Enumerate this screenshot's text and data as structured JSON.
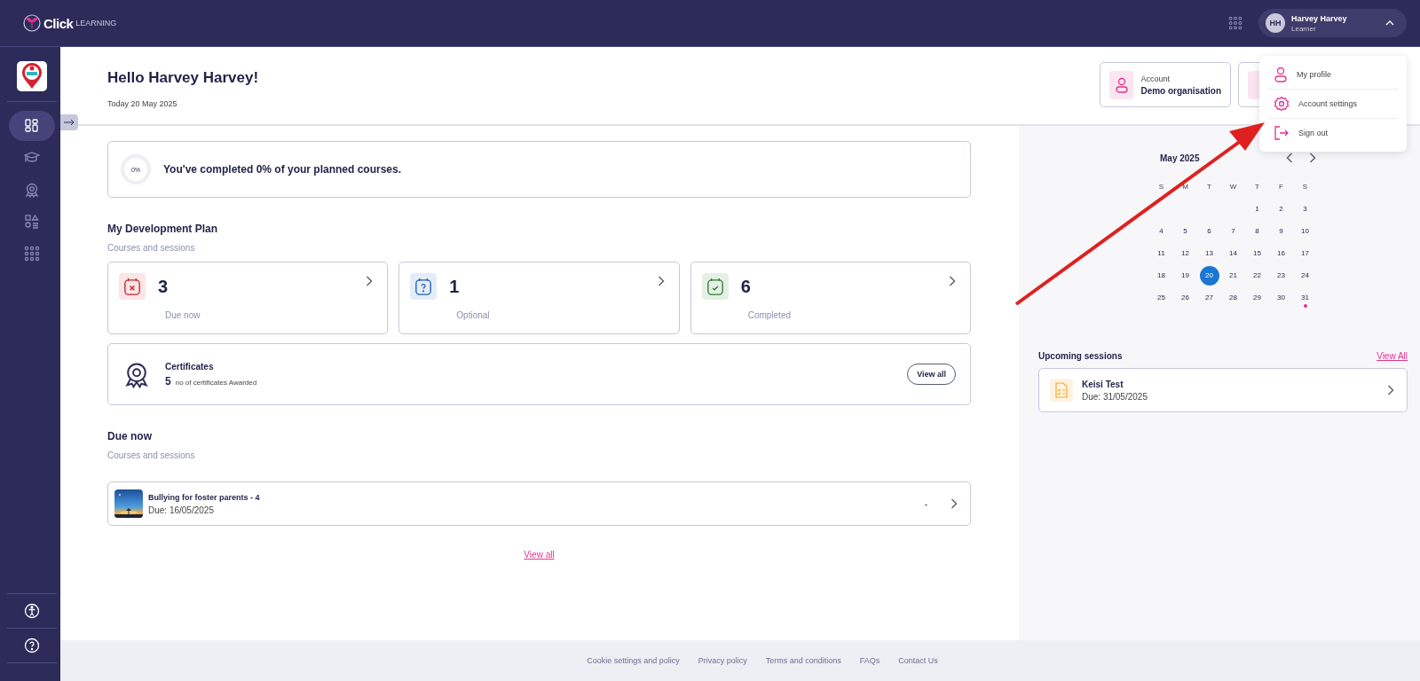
{
  "top_bar": {
    "logo_text": "Click",
    "logo_sub": "LEARNING",
    "user": {
      "initials": "HH",
      "name": "Harvey Harvey",
      "role": "Learner",
      "expanded": true
    }
  },
  "user_menu": [
    {
      "label": "My profile",
      "kind": "profile"
    },
    {
      "label": "Account settings",
      "kind": "settings"
    },
    {
      "label": "Sign out",
      "kind": "signout"
    }
  ],
  "sidebar": {
    "items": [
      {
        "kind": "dashboard",
        "selected": true
      },
      {
        "kind": "courses",
        "selected": false
      },
      {
        "kind": "certificates",
        "selected": false
      },
      {
        "kind": "catalogue",
        "selected": false
      },
      {
        "kind": "apps",
        "selected": false
      }
    ],
    "bottom": [
      {
        "kind": "accessibility"
      },
      {
        "kind": "help"
      }
    ]
  },
  "header": {
    "greeting": "Hello Harvey Harvey!",
    "date": "Today 20 May 2025",
    "account_cards": [
      {
        "kind": "account",
        "label": "Account",
        "value": "Demo organisation"
      },
      {
        "kind": "partial"
      }
    ]
  },
  "progress": {
    "percent_label": "0%",
    "message": "You've completed 0% of your planned courses.",
    "level": 0
  },
  "plan": {
    "title": "My Development Plan",
    "subtitle": "Courses and sessions",
    "stats": [
      {
        "kind": "overdue",
        "count": "3",
        "label": "Due now"
      },
      {
        "kind": "optional",
        "count": "1",
        "label": "Optional"
      },
      {
        "kind": "completed",
        "count": "6",
        "label": "Completed"
      }
    ]
  },
  "certificates": {
    "title": "Certificates",
    "count": "5",
    "caption": "no of certificates Awarded",
    "button": "View all"
  },
  "due_now": {
    "title": "Due now",
    "subtitle": "Courses and sessions",
    "items": [
      {
        "title": "Bullying for foster parents - 4",
        "due": "Due: 16/05/2025",
        "status": "-",
        "kind": "picture"
      }
    ],
    "view_all": "View all"
  },
  "calendar": {
    "month": "May 2025",
    "weekdays": [
      "S",
      "M",
      "T",
      "W",
      "T",
      "F",
      "S"
    ],
    "weeks": [
      [
        {
          "day": "1",
          "selected": false,
          "event": false
        },
        {
          "day": "2",
          "selected": false,
          "event": false
        },
        {
          "day": "3",
          "selected": false,
          "event": false
        }
      ],
      [
        {
          "day": "4",
          "selected": false,
          "event": false
        },
        {
          "day": "5",
          "selected": false,
          "event": false
        },
        {
          "day": "6",
          "selected": false,
          "event": false
        },
        {
          "day": "7",
          "selected": false,
          "event": false
        },
        {
          "day": "8",
          "selected": false,
          "event": false
        },
        {
          "day": "9",
          "selected": false,
          "event": false
        },
        {
          "day": "10",
          "selected": false,
          "event": false
        }
      ],
      [
        {
          "day": "11",
          "selected": false,
          "event": false
        },
        {
          "day": "12",
          "selected": false,
          "event": false
        },
        {
          "day": "13",
          "selected": false,
          "event": false
        },
        {
          "day": "14",
          "selected": false,
          "event": false
        },
        {
          "day": "15",
          "selected": false,
          "event": false
        },
        {
          "day": "16",
          "selected": false,
          "event": false
        },
        {
          "day": "17",
          "selected": false,
          "event": false
        }
      ],
      [
        {
          "day": "18",
          "selected": false,
          "event": false
        },
        {
          "day": "19",
          "selected": false,
          "event": false
        },
        {
          "day": "20",
          "selected": true,
          "event": false
        },
        {
          "day": "21",
          "selected": false,
          "event": false
        },
        {
          "day": "22",
          "selected": false,
          "event": false
        },
        {
          "day": "23",
          "selected": false,
          "event": false
        },
        {
          "day": "24",
          "selected": false,
          "event": false
        }
      ],
      [
        {
          "day": "25",
          "selected": false,
          "event": false
        },
        {
          "day": "26",
          "selected": false,
          "event": false
        },
        {
          "day": "27",
          "selected": false,
          "event": false
        },
        {
          "day": "28",
          "selected": false,
          "event": false
        },
        {
          "day": "29",
          "selected": false,
          "event": false
        },
        {
          "day": "30",
          "selected": false,
          "event": false
        },
        {
          "day": "31",
          "selected": false,
          "event": true
        }
      ]
    ]
  },
  "upcoming": {
    "title": "Upcoming sessions",
    "view_all": "View All",
    "items": [
      {
        "title": "Keisi Test",
        "due": "Due: 31/05/2025"
      }
    ]
  },
  "footer": {
    "links": [
      "Cookie settings and policy",
      "Privacy policy",
      "Terms and conditions",
      "FAQs",
      "Contact Us"
    ]
  }
}
